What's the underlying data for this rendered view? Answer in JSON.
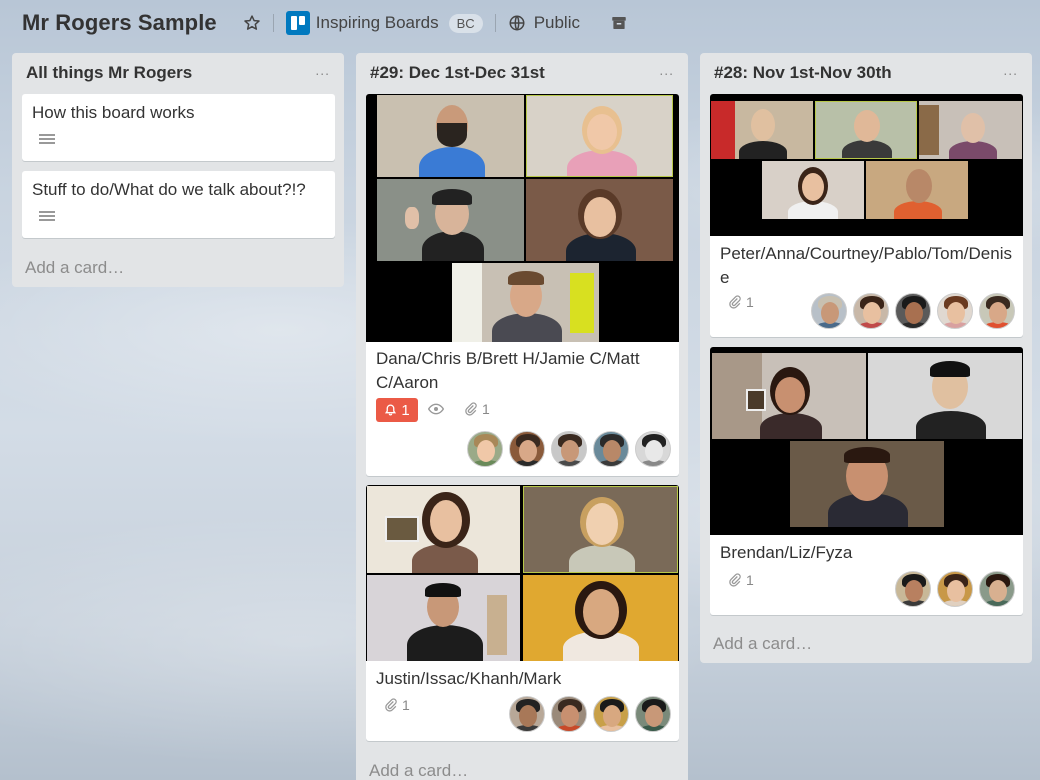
{
  "header": {
    "board_title": "Mr Rogers Sample",
    "team_name": "Inspiring Boards",
    "team_badge": "BC",
    "visibility": "Public",
    "icons": [
      "star-icon",
      "trello-logo-icon",
      "globe-icon",
      "archive-icon"
    ]
  },
  "lists": [
    {
      "title": "All things Mr Rogers",
      "menu": "...",
      "cards": [
        {
          "title": "How this board works",
          "has_description": true
        },
        {
          "title": "Stuff to do/What do we talk about?!?",
          "has_description": true
        }
      ],
      "add_card": "Add a card…"
    },
    {
      "title": "#29: Dec 1st-Dec 31st",
      "menu": "...",
      "cards": [
        {
          "title": "Dana/Chris B/Brett H/Jamie C/Matt C/Aaron",
          "notifications": "1",
          "watching": true,
          "attachments": "1",
          "member_count": 5
        },
        {
          "title": "Justin/Issac/Khanh/Mark",
          "attachments": "1",
          "member_count": 4
        }
      ],
      "add_card": "Add a card…"
    },
    {
      "title": "#28: Nov 1st-Nov 30th",
      "menu": "...",
      "cards": [
        {
          "title": "Peter/Anna/Courtney/Pablo/Tom/Denise",
          "attachments": "1",
          "member_count": 5
        },
        {
          "title": "Brendan/Liz/Fyza",
          "attachments": "1",
          "member_count": 3
        }
      ],
      "add_card": "Add a card…"
    }
  ],
  "colors": {
    "list_bg": "#e2e4e6",
    "card_bg": "#ffffff",
    "notification_red": "#eb5a46",
    "trello_blue": "#0079bf"
  }
}
